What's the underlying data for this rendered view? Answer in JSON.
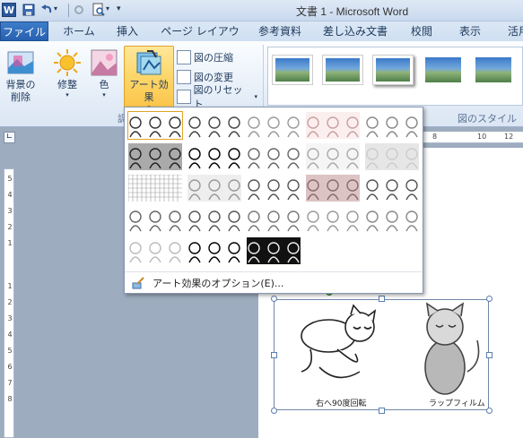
{
  "window": {
    "title": "文書 1 - Microsoft Word"
  },
  "qat": {
    "undo_arrow": "▾",
    "customize": "▾"
  },
  "tabs": [
    {
      "label": "ファイル"
    },
    {
      "label": "ホーム"
    },
    {
      "label": "挿入"
    },
    {
      "label": "ページ レイアウト"
    },
    {
      "label": "参考資料"
    },
    {
      "label": "差し込み文書"
    },
    {
      "label": "校閲"
    },
    {
      "label": "表示"
    },
    {
      "label": "活用"
    }
  ],
  "ribbon": {
    "remove_bg_label_1": "背景の",
    "remove_bg_label_2": "削除",
    "corrections_label": "修整",
    "color_label": "色",
    "artistic_label": "アート効果",
    "compress_label": "図の圧縮",
    "change_label": "図の変更",
    "reset_label": "図のリセット",
    "adjust_group_label": "調",
    "picture_styles_group_label": "図のスタイル",
    "dropdown_arrow": "▾"
  },
  "art_menu": {
    "option_label": "アート効果のオプション(E)...",
    "selected_index": 0,
    "effect_count": 23
  },
  "ruler": {
    "top_numbers": [
      "8",
      "10",
      "12"
    ],
    "left_numbers": [
      "5",
      "4",
      "3",
      "2",
      "1",
      "1",
      "2",
      "3",
      "4",
      "5",
      "6",
      "7",
      "8"
    ]
  },
  "document": {
    "caption_left": "右へ90度回転",
    "caption_right": "ラップフィルム"
  },
  "colors": {
    "file_tab": "#2b64b3",
    "accent_highlight": "#fcd66a"
  }
}
